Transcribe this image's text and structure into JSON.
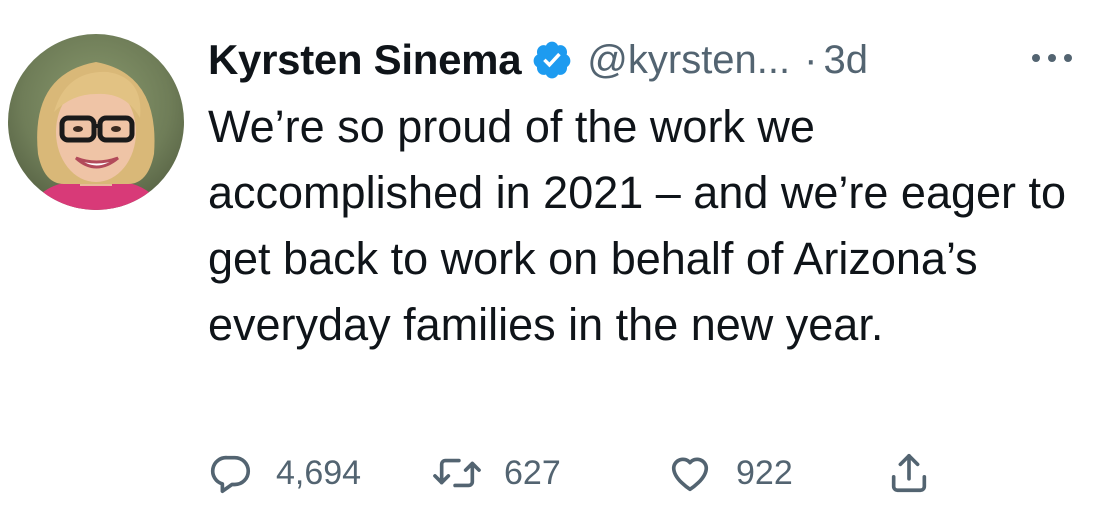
{
  "tweet": {
    "author": {
      "name": "Kyrsten Sinema",
      "handle": "@kyrsten...",
      "verified": true
    },
    "separator": "·",
    "timestamp": "3d",
    "text": "We’re so proud of the work we accomplished in 2021 – and we’re eager to get back to work on behalf of Arizona’s everyday families in the new year.",
    "stats": {
      "replies": "4,694",
      "retweets": "627",
      "likes": "922"
    }
  },
  "icons": {
    "verified": "verified-badge-icon",
    "more": "more-dots-icon",
    "reply": "reply-bubble-icon",
    "retweet": "retweet-arrows-icon",
    "like": "heart-icon",
    "share": "share-upload-icon"
  },
  "colors": {
    "primary_text": "#0f1419",
    "secondary_text": "#536471",
    "verified_blue": "#1d9bf0",
    "background": "#ffffff"
  }
}
